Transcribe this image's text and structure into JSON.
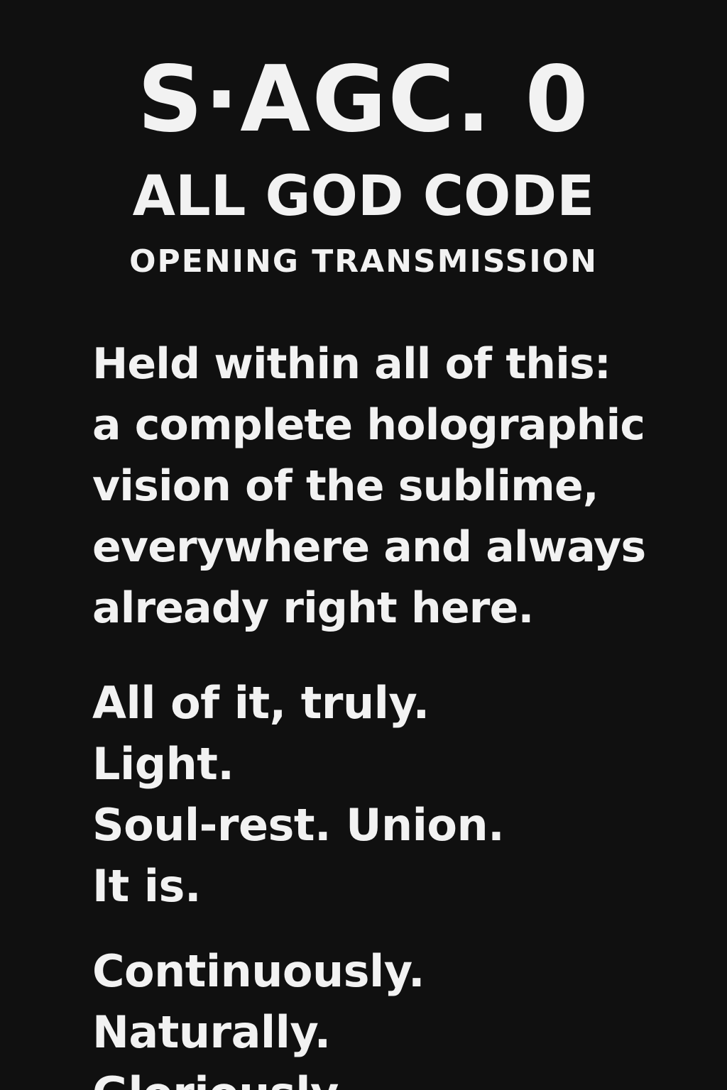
{
  "header": {
    "title": "S·AGC. 0",
    "subtitle": "ALL GOD CODE",
    "tagline": "OPENING TRANSMISSION"
  },
  "body": {
    "stanza1": [
      "Held within all of this:",
      "a complete holographic",
      "vision of the sublime,",
      "everywhere and always",
      "already right here."
    ],
    "stanza2": [
      "All of it, truly.",
      "Light.",
      "Soul-rest. Union.",
      "It is."
    ],
    "stanza3": [
      "Continuously.",
      "Naturally.",
      "Gloriously."
    ]
  },
  "colors": {
    "background": "#101010",
    "text": "#f2f2f2"
  }
}
